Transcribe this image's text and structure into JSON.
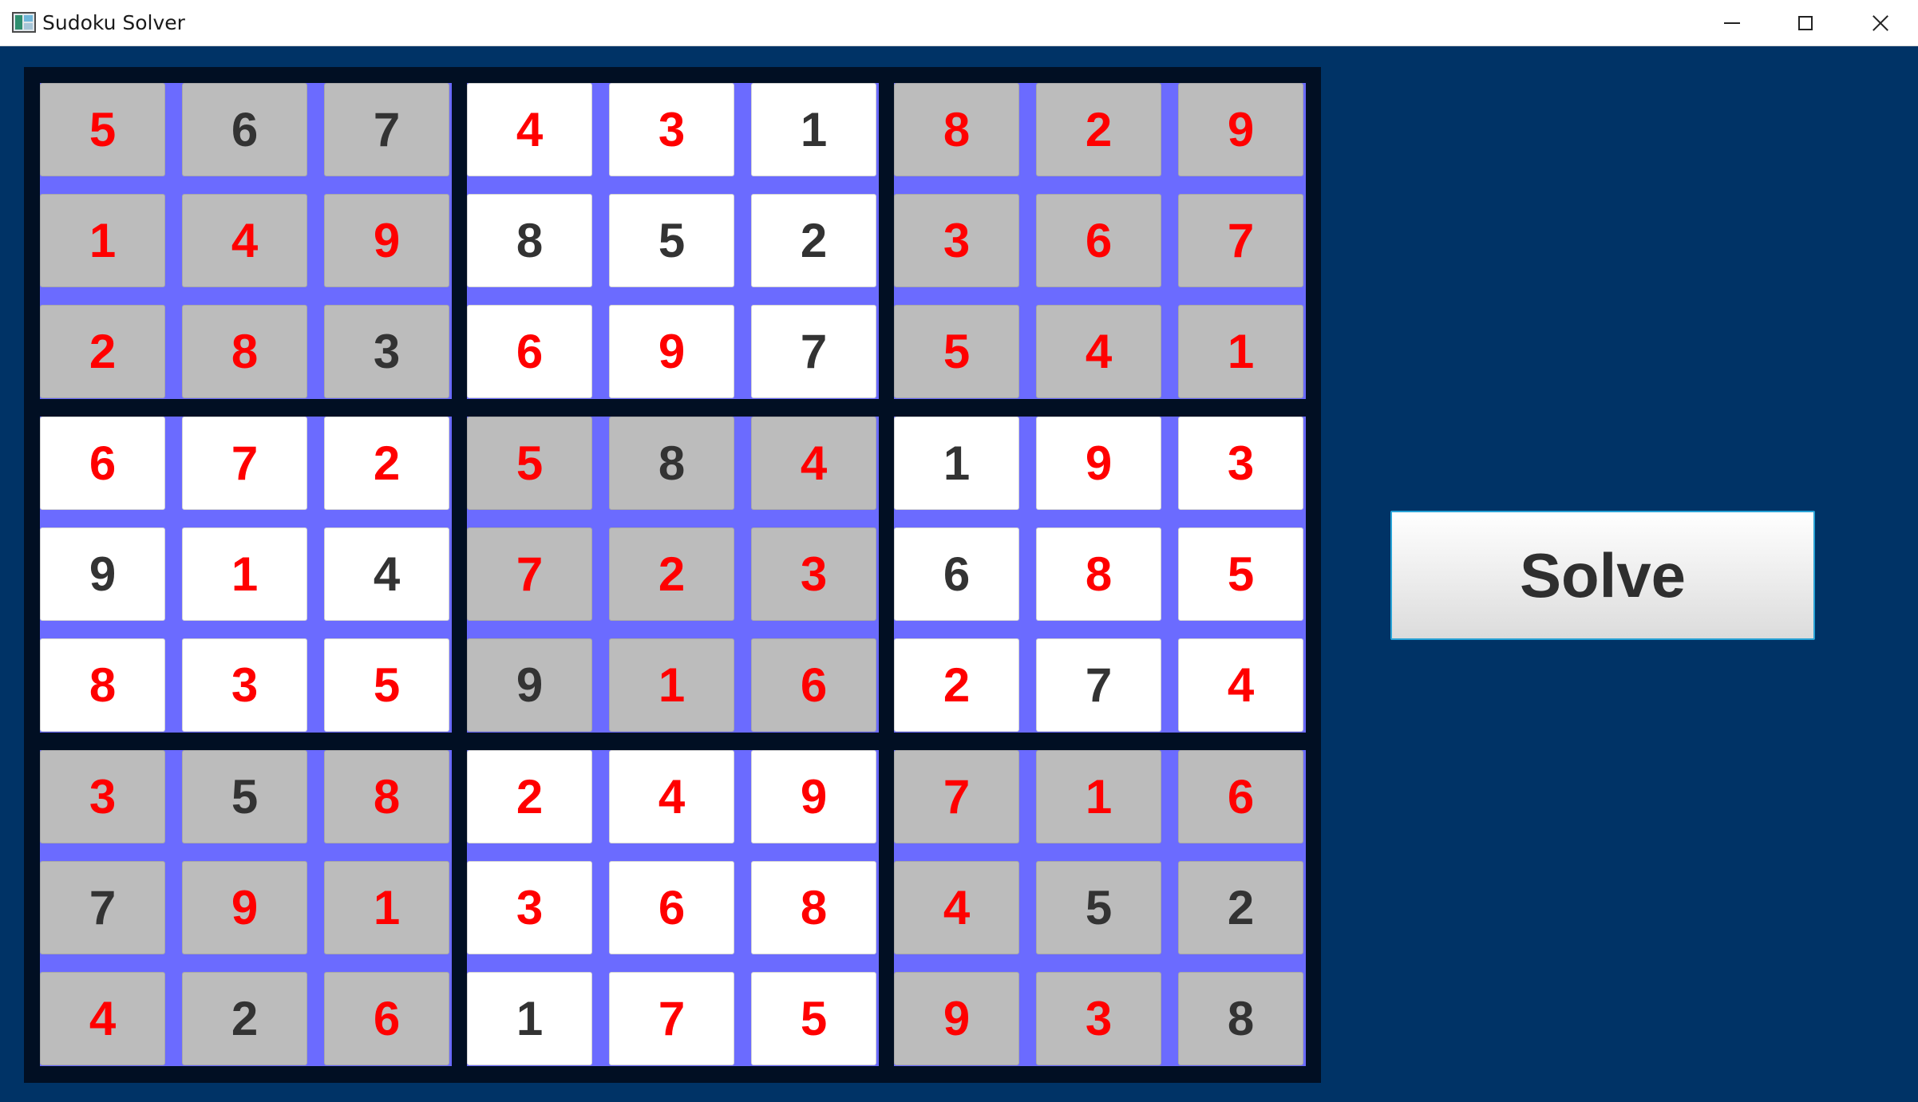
{
  "window": {
    "title": "Sudoku Solver"
  },
  "solve_button": {
    "label": "Solve"
  },
  "colors": {
    "background": "#003366",
    "board_frame": "#010f23",
    "box_gap": "#6b6bff",
    "cell_gray": "#bcbcbc",
    "cell_white": "#ffffff",
    "given_digit": "#333333",
    "solved_digit": "#ff0000"
  },
  "box_shading": [
    [
      "gray",
      "white",
      "gray"
    ],
    [
      "white",
      "gray",
      "white"
    ],
    [
      "gray",
      "white",
      "gray"
    ]
  ],
  "grid": [
    [
      "5",
      "6",
      "7",
      "4",
      "3",
      "1",
      "8",
      "2",
      "9"
    ],
    [
      "1",
      "4",
      "9",
      "8",
      "5",
      "2",
      "3",
      "6",
      "7"
    ],
    [
      "2",
      "8",
      "3",
      "6",
      "9",
      "7",
      "5",
      "4",
      "1"
    ],
    [
      "6",
      "7",
      "2",
      "5",
      "8",
      "4",
      "1",
      "9",
      "3"
    ],
    [
      "9",
      "1",
      "4",
      "7",
      "2",
      "3",
      "6",
      "8",
      "5"
    ],
    [
      "8",
      "3",
      "5",
      "9",
      "1",
      "6",
      "2",
      "7",
      "4"
    ],
    [
      "3",
      "5",
      "8",
      "2",
      "4",
      "9",
      "7",
      "1",
      "6"
    ],
    [
      "7",
      "9",
      "1",
      "3",
      "6",
      "8",
      "4",
      "5",
      "2"
    ],
    [
      "4",
      "2",
      "6",
      "1",
      "7",
      "5",
      "9",
      "3",
      "8"
    ]
  ],
  "given": [
    [
      0,
      1,
      1,
      0,
      0,
      1,
      0,
      0,
      0
    ],
    [
      0,
      0,
      0,
      1,
      1,
      1,
      0,
      0,
      0
    ],
    [
      0,
      0,
      1,
      0,
      0,
      1,
      0,
      0,
      0
    ],
    [
      0,
      0,
      0,
      0,
      1,
      0,
      1,
      0,
      0
    ],
    [
      1,
      0,
      1,
      0,
      0,
      0,
      1,
      0,
      0
    ],
    [
      0,
      0,
      0,
      1,
      0,
      0,
      0,
      1,
      0
    ],
    [
      0,
      1,
      0,
      0,
      0,
      0,
      0,
      0,
      0
    ],
    [
      1,
      0,
      0,
      0,
      0,
      0,
      0,
      1,
      1
    ],
    [
      0,
      1,
      0,
      1,
      0,
      0,
      0,
      0,
      1
    ]
  ]
}
